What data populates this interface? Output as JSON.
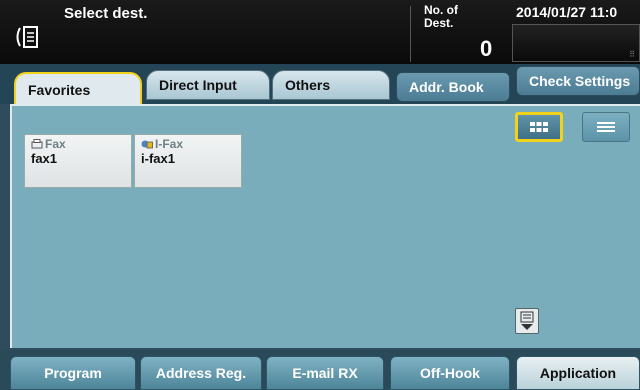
{
  "header": {
    "title": "Select dest.",
    "num_dest_label": "No. of Dest.",
    "num_dest_value": "0",
    "datetime": "2014/01/27 11:0"
  },
  "tabs": [
    {
      "label": "Favorites",
      "selected": true
    },
    {
      "label": "Direct Input",
      "selected": false
    },
    {
      "label": "Others",
      "selected": false
    }
  ],
  "addr_book_label": "Addr. Book",
  "check_settings_label": "Check Settings",
  "destinations": [
    {
      "type": "Fax",
      "name": "fax1",
      "icon": "fax-icon"
    },
    {
      "type": "I-Fax",
      "name": "i-fax1",
      "icon": "ifax-icon"
    }
  ],
  "view_modes": [
    "grid-view",
    "list-view"
  ],
  "bottom_buttons": [
    "Program",
    "Address Reg.",
    "E-mail RX",
    "Off-Hook",
    "Application"
  ],
  "colors": {
    "selected_border": "#f2d21b",
    "panel": "#79adbb",
    "header": "#0a0a0a"
  }
}
